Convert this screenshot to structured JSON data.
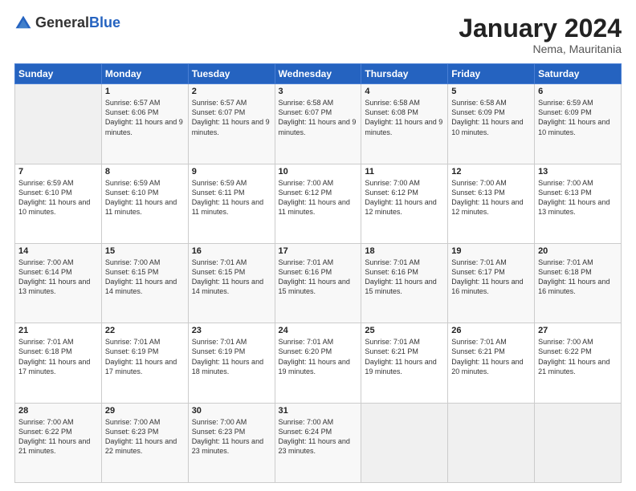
{
  "logo": {
    "general": "General",
    "blue": "Blue"
  },
  "title": "January 2024",
  "location": "Nema, Mauritania",
  "weekdays": [
    "Sunday",
    "Monday",
    "Tuesday",
    "Wednesday",
    "Thursday",
    "Friday",
    "Saturday"
  ],
  "weeks": [
    [
      {
        "day": "",
        "sunrise": "",
        "sunset": "",
        "daylight": "",
        "empty": true
      },
      {
        "day": "1",
        "sunrise": "Sunrise: 6:57 AM",
        "sunset": "Sunset: 6:06 PM",
        "daylight": "Daylight: 11 hours and 9 minutes."
      },
      {
        "day": "2",
        "sunrise": "Sunrise: 6:57 AM",
        "sunset": "Sunset: 6:07 PM",
        "daylight": "Daylight: 11 hours and 9 minutes."
      },
      {
        "day": "3",
        "sunrise": "Sunrise: 6:58 AM",
        "sunset": "Sunset: 6:07 PM",
        "daylight": "Daylight: 11 hours and 9 minutes."
      },
      {
        "day": "4",
        "sunrise": "Sunrise: 6:58 AM",
        "sunset": "Sunset: 6:08 PM",
        "daylight": "Daylight: 11 hours and 9 minutes."
      },
      {
        "day": "5",
        "sunrise": "Sunrise: 6:58 AM",
        "sunset": "Sunset: 6:09 PM",
        "daylight": "Daylight: 11 hours and 10 minutes."
      },
      {
        "day": "6",
        "sunrise": "Sunrise: 6:59 AM",
        "sunset": "Sunset: 6:09 PM",
        "daylight": "Daylight: 11 hours and 10 minutes."
      }
    ],
    [
      {
        "day": "7",
        "sunrise": "Sunrise: 6:59 AM",
        "sunset": "Sunset: 6:10 PM",
        "daylight": "Daylight: 11 hours and 10 minutes."
      },
      {
        "day": "8",
        "sunrise": "Sunrise: 6:59 AM",
        "sunset": "Sunset: 6:10 PM",
        "daylight": "Daylight: 11 hours and 11 minutes."
      },
      {
        "day": "9",
        "sunrise": "Sunrise: 6:59 AM",
        "sunset": "Sunset: 6:11 PM",
        "daylight": "Daylight: 11 hours and 11 minutes."
      },
      {
        "day": "10",
        "sunrise": "Sunrise: 7:00 AM",
        "sunset": "Sunset: 6:12 PM",
        "daylight": "Daylight: 11 hours and 11 minutes."
      },
      {
        "day": "11",
        "sunrise": "Sunrise: 7:00 AM",
        "sunset": "Sunset: 6:12 PM",
        "daylight": "Daylight: 11 hours and 12 minutes."
      },
      {
        "day": "12",
        "sunrise": "Sunrise: 7:00 AM",
        "sunset": "Sunset: 6:13 PM",
        "daylight": "Daylight: 11 hours and 12 minutes."
      },
      {
        "day": "13",
        "sunrise": "Sunrise: 7:00 AM",
        "sunset": "Sunset: 6:13 PM",
        "daylight": "Daylight: 11 hours and 13 minutes."
      }
    ],
    [
      {
        "day": "14",
        "sunrise": "Sunrise: 7:00 AM",
        "sunset": "Sunset: 6:14 PM",
        "daylight": "Daylight: 11 hours and 13 minutes."
      },
      {
        "day": "15",
        "sunrise": "Sunrise: 7:00 AM",
        "sunset": "Sunset: 6:15 PM",
        "daylight": "Daylight: 11 hours and 14 minutes."
      },
      {
        "day": "16",
        "sunrise": "Sunrise: 7:01 AM",
        "sunset": "Sunset: 6:15 PM",
        "daylight": "Daylight: 11 hours and 14 minutes."
      },
      {
        "day": "17",
        "sunrise": "Sunrise: 7:01 AM",
        "sunset": "Sunset: 6:16 PM",
        "daylight": "Daylight: 11 hours and 15 minutes."
      },
      {
        "day": "18",
        "sunrise": "Sunrise: 7:01 AM",
        "sunset": "Sunset: 6:16 PM",
        "daylight": "Daylight: 11 hours and 15 minutes."
      },
      {
        "day": "19",
        "sunrise": "Sunrise: 7:01 AM",
        "sunset": "Sunset: 6:17 PM",
        "daylight": "Daylight: 11 hours and 16 minutes."
      },
      {
        "day": "20",
        "sunrise": "Sunrise: 7:01 AM",
        "sunset": "Sunset: 6:18 PM",
        "daylight": "Daylight: 11 hours and 16 minutes."
      }
    ],
    [
      {
        "day": "21",
        "sunrise": "Sunrise: 7:01 AM",
        "sunset": "Sunset: 6:18 PM",
        "daylight": "Daylight: 11 hours and 17 minutes."
      },
      {
        "day": "22",
        "sunrise": "Sunrise: 7:01 AM",
        "sunset": "Sunset: 6:19 PM",
        "daylight": "Daylight: 11 hours and 17 minutes."
      },
      {
        "day": "23",
        "sunrise": "Sunrise: 7:01 AM",
        "sunset": "Sunset: 6:19 PM",
        "daylight": "Daylight: 11 hours and 18 minutes."
      },
      {
        "day": "24",
        "sunrise": "Sunrise: 7:01 AM",
        "sunset": "Sunset: 6:20 PM",
        "daylight": "Daylight: 11 hours and 19 minutes."
      },
      {
        "day": "25",
        "sunrise": "Sunrise: 7:01 AM",
        "sunset": "Sunset: 6:21 PM",
        "daylight": "Daylight: 11 hours and 19 minutes."
      },
      {
        "day": "26",
        "sunrise": "Sunrise: 7:01 AM",
        "sunset": "Sunset: 6:21 PM",
        "daylight": "Daylight: 11 hours and 20 minutes."
      },
      {
        "day": "27",
        "sunrise": "Sunrise: 7:00 AM",
        "sunset": "Sunset: 6:22 PM",
        "daylight": "Daylight: 11 hours and 21 minutes."
      }
    ],
    [
      {
        "day": "28",
        "sunrise": "Sunrise: 7:00 AM",
        "sunset": "Sunset: 6:22 PM",
        "daylight": "Daylight: 11 hours and 21 minutes."
      },
      {
        "day": "29",
        "sunrise": "Sunrise: 7:00 AM",
        "sunset": "Sunset: 6:23 PM",
        "daylight": "Daylight: 11 hours and 22 minutes."
      },
      {
        "day": "30",
        "sunrise": "Sunrise: 7:00 AM",
        "sunset": "Sunset: 6:23 PM",
        "daylight": "Daylight: 11 hours and 23 minutes."
      },
      {
        "day": "31",
        "sunrise": "Sunrise: 7:00 AM",
        "sunset": "Sunset: 6:24 PM",
        "daylight": "Daylight: 11 hours and 23 minutes."
      },
      {
        "day": "",
        "sunrise": "",
        "sunset": "",
        "daylight": "",
        "empty": true
      },
      {
        "day": "",
        "sunrise": "",
        "sunset": "",
        "daylight": "",
        "empty": true
      },
      {
        "day": "",
        "sunrise": "",
        "sunset": "",
        "daylight": "",
        "empty": true
      }
    ]
  ]
}
